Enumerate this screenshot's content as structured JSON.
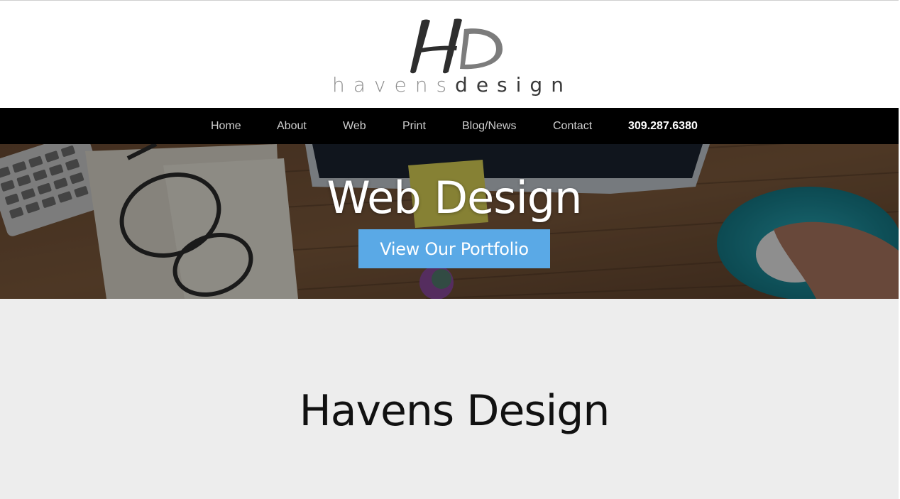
{
  "logo": {
    "monogram": "HD",
    "wordmark_light": "havens",
    "wordmark_dark": "design"
  },
  "nav": {
    "items": [
      {
        "label": "Home"
      },
      {
        "label": "About"
      },
      {
        "label": "Web"
      },
      {
        "label": "Print"
      },
      {
        "label": "Blog/News"
      },
      {
        "label": "Contact"
      }
    ],
    "phone": "309.287.6380"
  },
  "hero": {
    "title": "Web Design",
    "button_label": "View Our Portfolio"
  },
  "section": {
    "title": "Havens Design"
  },
  "colors": {
    "nav_background": "#000000",
    "button_accent": "#5aa9e6",
    "section_background": "#ededed"
  }
}
